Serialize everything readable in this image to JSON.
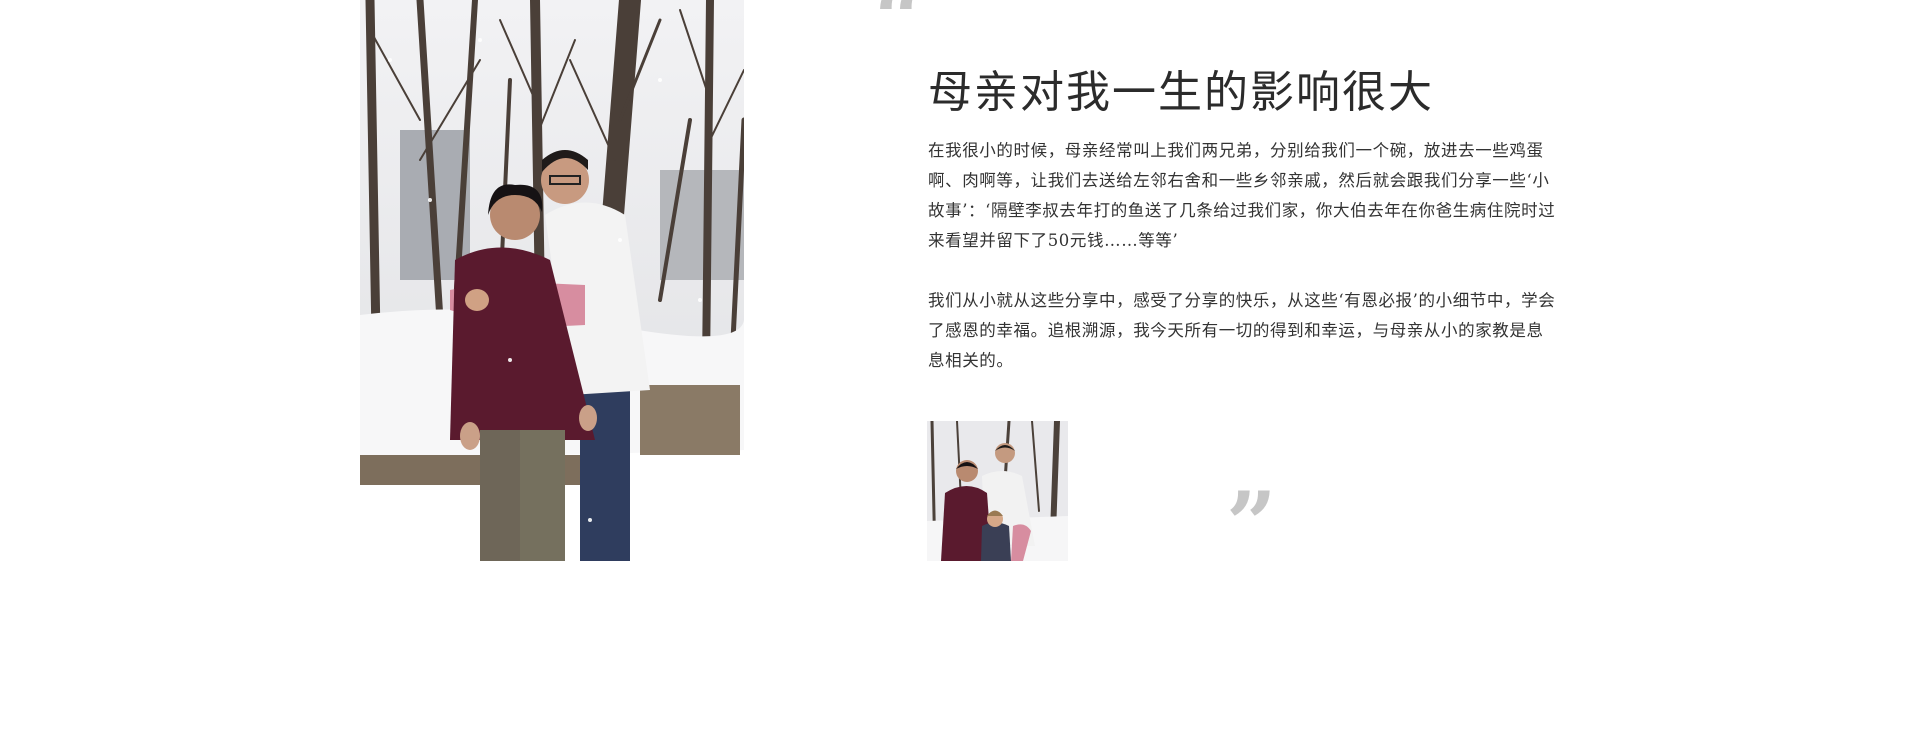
{
  "article": {
    "heading": "母亲对我一生的影响很大",
    "paragraph_1": "在我很小的时候，母亲经常叫上我们两兄弟，分别给我们一个碗，放进去一些鸡蛋啊、肉啊等，让我们去送给左邻右舍和一些乡邻亲戚，然后就会跟我们分享一些‘小故事’：‘隔壁李叔去年打的鱼送了几条给过我们家，你大伯去年在你爸生病住院时过来看望并留下了50元钱……等等’",
    "paragraph_2": "我们从小就从这些分享中，感受了分享的快乐，从这些‘有恩必报’的小细节中，学会了感恩的幸福。追根溯源，我今天所有一切的得到和幸运，与母亲从小的家教是息息相关的。",
    "quote_open": "“",
    "quote_close": "”"
  },
  "images": {
    "main_photo": "snow-scene-mother-and-son-photo",
    "small_photo": "snow-scene-family-with-child-photo"
  },
  "colors": {
    "background": "#ffffff",
    "heading_text": "#2b2b2b",
    "body_text": "#333333",
    "quote_marks": "#c6c6c6"
  }
}
